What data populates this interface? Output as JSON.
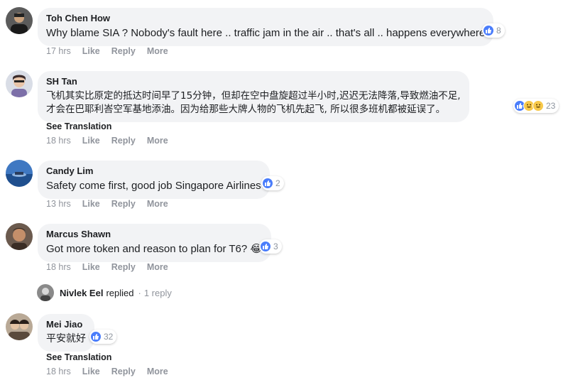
{
  "colors": {
    "like": "#4a7dfb",
    "haha": "#f7c84a",
    "bubble": "#f2f3f5",
    "meta": "#90949c"
  },
  "action_labels": {
    "like": "Like",
    "reply": "Reply",
    "more": "More",
    "translate": "See Translation"
  },
  "comments": [
    {
      "author": "Toh Chen How",
      "text": "Why blame SIA ? Nobody's fault here .. traffic jam in the air .. that's all .. happens everywhere",
      "reactions": [
        "like"
      ],
      "reaction_count": "8",
      "time": "17 hrs"
    },
    {
      "author": "SH Tan",
      "text_lines": [
        "飞机其实比原定的抵达时间早了15分钟，但却在空中盘旋超过半小时,迟迟无法降落,导致燃油不足,",
        "才会在巴耶利峇空军基地添油。因为给那些大牌人物的飞机先起飞, 所以很多班机都被延误了。"
      ],
      "reactions": [
        "like",
        "haha",
        "haha"
      ],
      "reaction_count": "23",
      "time": "18 hrs"
    },
    {
      "author": "Candy Lim",
      "text": "Safety come first, good job Singapore Airlines",
      "reactions": [
        "like"
      ],
      "reaction_count": "2",
      "time": "13 hrs"
    },
    {
      "author": "Marcus Shawn",
      "text": "Got more token and reason to plan for T6? ",
      "emoji": "😂",
      "reactions": [
        "like"
      ],
      "reaction_count": "3",
      "time": "18 hrs"
    },
    {
      "author": "Mei Jiao",
      "text": "平安就好",
      "reactions": [
        "like"
      ],
      "reaction_count": "32",
      "time": "18 hrs"
    }
  ],
  "reply_summary": {
    "name": "Nivlek Eel",
    "verb": "replied",
    "separator": "·",
    "count": "1 reply"
  }
}
